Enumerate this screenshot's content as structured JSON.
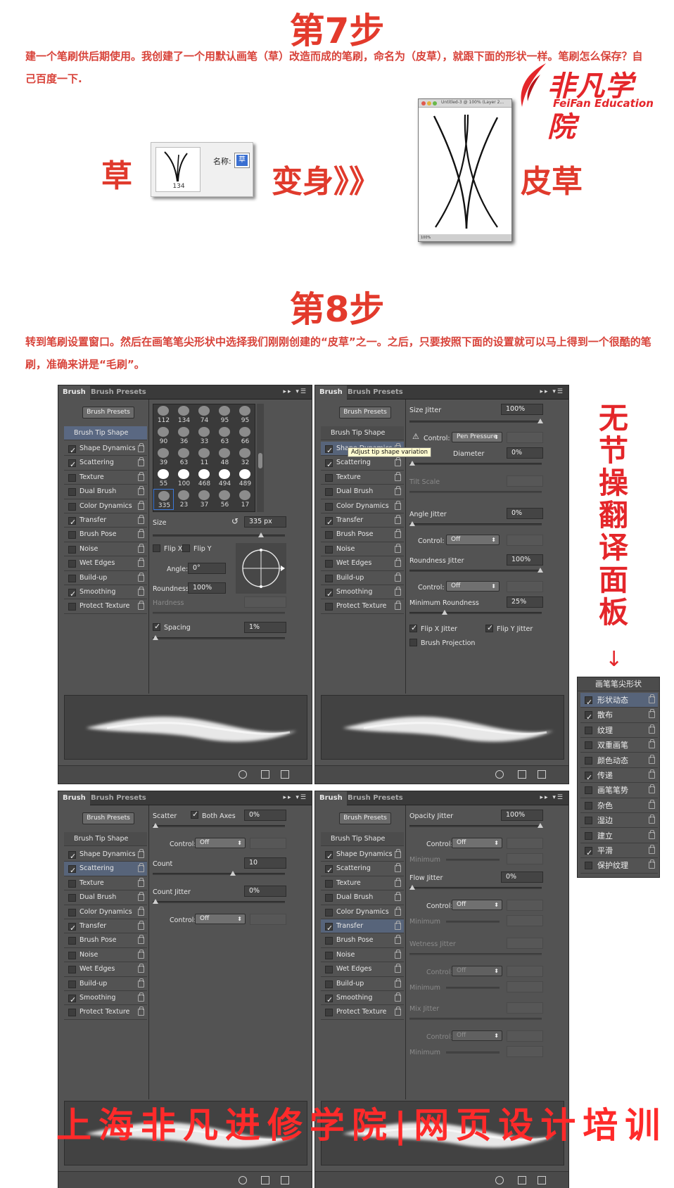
{
  "step7": {
    "title": "第7步",
    "text": "建一个笔刷供后期使用。我创建了一个用默认画笔（草）改造而成的笔刷，命名为（皮草），就跟下面的形状一样。笔刷怎么保存？自己百度一下.",
    "left_word": "草",
    "middle_word": "变身》》",
    "right_word": "皮草",
    "thumb_number": "134",
    "name_label": "名称:",
    "name_value": "草",
    "doc_title": "Untitled-3 @ 100% (Layer 2...",
    "doc_zoom": "100%"
  },
  "logo": {
    "cn": "非凡学院",
    "en": "FeiFan Education"
  },
  "step8": {
    "title": "第8步",
    "text": "转到笔刷设置窗口。然后在画笔笔尖形状中选择我们刚刚创建的“皮草”之一。之后，只要按照下面的设置就可以马上得到一个很酷的笔刷，准确来讲是“毛刷”。"
  },
  "panel_common": {
    "tab_brush": "Brush",
    "tab_presets": "Brush Presets",
    "presets_btn": "Brush Presets",
    "items": [
      {
        "label": "Brush Tip Shape",
        "checked": false,
        "header": true
      },
      {
        "label": "Shape Dynamics",
        "checked": true
      },
      {
        "label": "Scattering",
        "checked": true
      },
      {
        "label": "Texture",
        "checked": false
      },
      {
        "label": "Dual Brush",
        "checked": false
      },
      {
        "label": "Color Dynamics",
        "checked": false
      },
      {
        "label": "Transfer",
        "checked": true
      },
      {
        "label": "Brush Pose",
        "checked": false
      },
      {
        "label": "Noise",
        "checked": false
      },
      {
        "label": "Wet Edges",
        "checked": false
      },
      {
        "label": "Build-up",
        "checked": false
      },
      {
        "label": "Smoothing",
        "checked": true
      },
      {
        "label": "Protect Texture",
        "checked": false
      }
    ]
  },
  "p1": {
    "tips": [
      "112",
      "134",
      "74",
      "95",
      "95",
      "90",
      "36",
      "33",
      "63",
      "66",
      "39",
      "63",
      "11",
      "48",
      "32",
      "55",
      "100",
      "468",
      "494",
      "489",
      "335",
      "23",
      "37",
      "56",
      "17"
    ],
    "size_label": "Size",
    "size_value": "335 px",
    "flip_x": "Flip X",
    "flip_y": "Flip Y",
    "angle_label": "Angle:",
    "angle_value": "0°",
    "roundness_label": "Roundness:",
    "roundness_value": "100%",
    "hardness_label": "Hardness",
    "spacing_label": "Spacing",
    "spacing_value": "1%"
  },
  "p2": {
    "size_jitter_label": "Size Jitter",
    "size_jitter_value": "100%",
    "control_label": "Control:",
    "control_value": "Pen Pressure",
    "tooltip": "Adjust tip shape variation",
    "min_diameter_label": "Diameter",
    "min_diameter_value": "0%",
    "tilt_scale_label": "Tilt Scale",
    "angle_jitter_label": "Angle Jitter",
    "angle_jitter_value": "0%",
    "angle_control_value": "Off",
    "roundness_jitter_label": "Roundness Jitter",
    "roundness_jitter_value": "100%",
    "roundness_control_value": "Off",
    "min_roundness_label": "Minimum Roundness",
    "min_roundness_value": "25%",
    "flip_x_jitter": "Flip X Jitter",
    "flip_y_jitter": "Flip Y Jitter",
    "brush_projection": "Brush Projection"
  },
  "p3": {
    "scatter_label": "Scatter",
    "both_axes_label": "Both Axes",
    "scatter_value": "0%",
    "control_label": "Control:",
    "control_value": "Off",
    "count_label": "Count",
    "count_value": "10",
    "count_jitter_label": "Count Jitter",
    "count_jitter_value": "0%",
    "count_control_value": "Off"
  },
  "p4": {
    "opacity_jitter_label": "Opacity Jitter",
    "opacity_jitter_value": "100%",
    "control_label": "Control:",
    "control_value": "Off",
    "minimum_label": "Minimum",
    "flow_jitter_label": "Flow Jitter",
    "flow_jitter_value": "0%",
    "wetness_jitter_label": "Wetness Jitter",
    "mix_jitter_label": "Mix Jitter"
  },
  "translate": {
    "vertical": "无节操翻译面板",
    "arrow": "↓",
    "header": "画笔笔尖形状",
    "items": [
      {
        "label": "形状动态",
        "checked": true
      },
      {
        "label": "散布",
        "checked": true
      },
      {
        "label": "纹理",
        "checked": false
      },
      {
        "label": "双重画笔",
        "checked": false
      },
      {
        "label": "颜色动态",
        "checked": false
      },
      {
        "label": "传递",
        "checked": true
      },
      {
        "label": "画笔笔势",
        "checked": false
      },
      {
        "label": "杂色",
        "checked": false
      },
      {
        "label": "湿边",
        "checked": false
      },
      {
        "label": "建立",
        "checked": false
      },
      {
        "label": "平滑",
        "checked": true
      },
      {
        "label": "保护纹理",
        "checked": false
      }
    ]
  },
  "watermark": "上海非凡进修学院|网页设计培训",
  "colors": {
    "accent": "#e33a2c",
    "panel_bg": "#535353",
    "selected": "#57647a"
  }
}
